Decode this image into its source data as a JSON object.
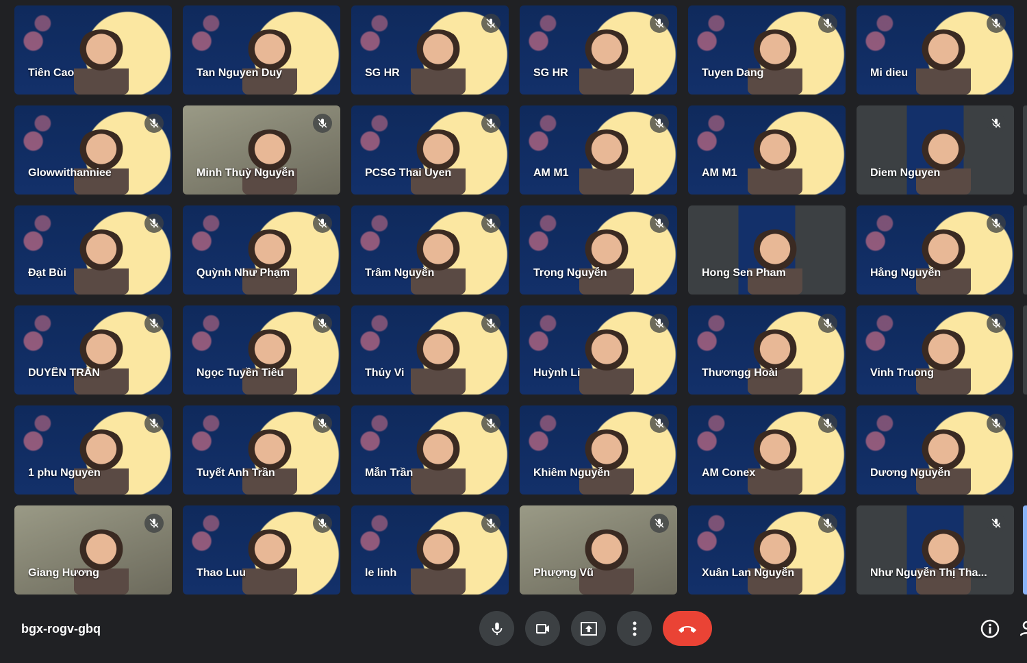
{
  "meeting_code": "bgx-rogv-gbq",
  "colors": {
    "background": "#202124",
    "button": "#3c4043",
    "end_call": "#ea4335",
    "moon_bg": "#13306a",
    "moon": "#fbe7a1"
  },
  "participants": [
    {
      "name": "Tiên Cao",
      "bg": "moon",
      "muted": false
    },
    {
      "name": "Tan Nguyen Duy",
      "bg": "moon",
      "muted": false
    },
    {
      "name": "SG HR",
      "bg": "moon",
      "muted": true
    },
    {
      "name": "SG HR",
      "bg": "moon",
      "muted": true
    },
    {
      "name": "Tuyen Dang",
      "bg": "moon",
      "muted": true
    },
    {
      "name": "Mi dieu",
      "bg": "moon",
      "muted": true
    },
    {
      "name": "Glowwithanniee",
      "bg": "moon",
      "muted": true
    },
    {
      "name": "Minh Thuỳ Nguyễn",
      "bg": "plain",
      "muted": true
    },
    {
      "name": "PCSG Thai Uyen",
      "bg": "moon",
      "muted": true
    },
    {
      "name": "AM M1",
      "bg": "moon",
      "muted": true
    },
    {
      "name": "AM M1",
      "bg": "moon",
      "muted": false
    },
    {
      "name": "Diem Nguyen",
      "bg": "half",
      "muted": true
    },
    {
      "name": "Đạt Bùi",
      "bg": "moon",
      "muted": true
    },
    {
      "name": "Quỳnh Như Phạm",
      "bg": "moon",
      "muted": true
    },
    {
      "name": "Trâm Nguyễn",
      "bg": "moon",
      "muted": true
    },
    {
      "name": "Trọng Nguyễn",
      "bg": "moon",
      "muted": true
    },
    {
      "name": "Hong Sen Pham",
      "bg": "half",
      "muted": false
    },
    {
      "name": "Hằng Nguyễn",
      "bg": "moon",
      "muted": true
    },
    {
      "name": "DUYÊN TRẦN",
      "bg": "moon",
      "muted": true
    },
    {
      "name": "Ngọc Tuyền Tiêu",
      "bg": "moon",
      "muted": true
    },
    {
      "name": "Thủy Vi",
      "bg": "moon",
      "muted": true
    },
    {
      "name": "Huỳnh Li",
      "bg": "moon",
      "muted": true
    },
    {
      "name": "Thươngg Hoài",
      "bg": "moon",
      "muted": true
    },
    {
      "name": "Vinh Truong",
      "bg": "moon",
      "muted": true
    },
    {
      "name": "1 phu Nguyen",
      "bg": "moon",
      "muted": true
    },
    {
      "name": "Tuyết Anh Trần",
      "bg": "moon",
      "muted": true
    },
    {
      "name": "Mẫn Trần",
      "bg": "moon",
      "muted": true
    },
    {
      "name": "Khiêm Nguyễn",
      "bg": "moon",
      "muted": true
    },
    {
      "name": "AM Conex",
      "bg": "moon",
      "muted": true
    },
    {
      "name": "Dương Nguyễn",
      "bg": "moon",
      "muted": true
    },
    {
      "name": "Giang Hương",
      "bg": "plain",
      "muted": true
    },
    {
      "name": "Thao Luu",
      "bg": "moon",
      "muted": true
    },
    {
      "name": "le linh",
      "bg": "moon",
      "muted": true
    },
    {
      "name": "Phượng Vũ",
      "bg": "plain",
      "muted": true
    },
    {
      "name": "Xuân Lan Nguyễn",
      "bg": "moon",
      "muted": true
    },
    {
      "name": "Như Nguyễn Thị Tha...",
      "bg": "half",
      "muted": true
    }
  ],
  "controls": [
    {
      "name": "microphone",
      "icon": "mic-icon"
    },
    {
      "name": "camera",
      "icon": "video-camera-icon"
    },
    {
      "name": "present",
      "icon": "present-screen-icon"
    },
    {
      "name": "more",
      "icon": "more-vertical-icon"
    },
    {
      "name": "leave-call",
      "icon": "hang-up-icon"
    }
  ]
}
